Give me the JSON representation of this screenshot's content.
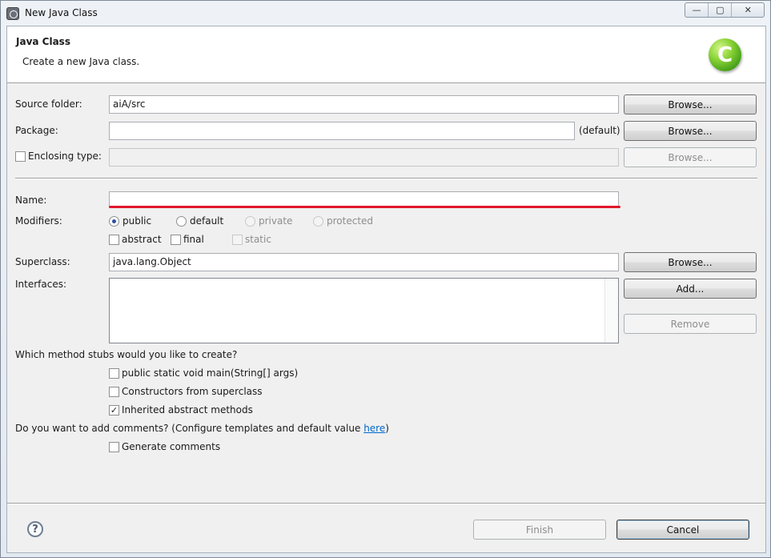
{
  "window": {
    "title": "New Java Class",
    "controls": {
      "minimize": "—",
      "maximize": "▢",
      "close": "✕"
    }
  },
  "banner": {
    "title": "Java Class",
    "description": "Create a new Java class.",
    "logo_letter": "C",
    "logo_color": "#5cb82a"
  },
  "source_folder": {
    "label": "Source folder:",
    "value": "aiA/src",
    "browse": "Browse..."
  },
  "package": {
    "label": "Package:",
    "value": "",
    "suffix": "(default)",
    "browse": "Browse..."
  },
  "enclosing_type": {
    "label": "Enclosing type:",
    "checked": false,
    "value": "",
    "browse": "Browse..."
  },
  "name": {
    "label": "Name:",
    "value": "",
    "highlight_color": "#e0162b"
  },
  "modifiers": {
    "label": "Modifiers:",
    "access": [
      {
        "label": "public",
        "selected": true,
        "enabled": true
      },
      {
        "label": "default",
        "selected": false,
        "enabled": true
      },
      {
        "label": "private",
        "selected": false,
        "enabled": false
      },
      {
        "label": "protected",
        "selected": false,
        "enabled": false
      }
    ],
    "flags": [
      {
        "label": "abstract",
        "checked": false,
        "enabled": true
      },
      {
        "label": "final",
        "checked": false,
        "enabled": true
      },
      {
        "label": "static",
        "checked": false,
        "enabled": false
      }
    ]
  },
  "superclass": {
    "label": "Superclass:",
    "value": "java.lang.Object",
    "browse": "Browse..."
  },
  "interfaces": {
    "label": "Interfaces:",
    "items": [],
    "add": "Add...",
    "remove": "Remove"
  },
  "method_stubs": {
    "question": "Which method stubs would you like to create?",
    "options": [
      {
        "label": "public static void main(String[] args)",
        "checked": false
      },
      {
        "label": "Constructors from superclass",
        "checked": false
      },
      {
        "label": "Inherited abstract methods",
        "checked": true
      }
    ]
  },
  "comments": {
    "question_prefix": "Do you want to add comments? (Configure templates and default value ",
    "link": "here",
    "question_suffix": ")",
    "option": {
      "label": "Generate comments",
      "checked": false
    }
  },
  "footer": {
    "help": "?",
    "finish": "Finish",
    "cancel": "Cancel"
  }
}
